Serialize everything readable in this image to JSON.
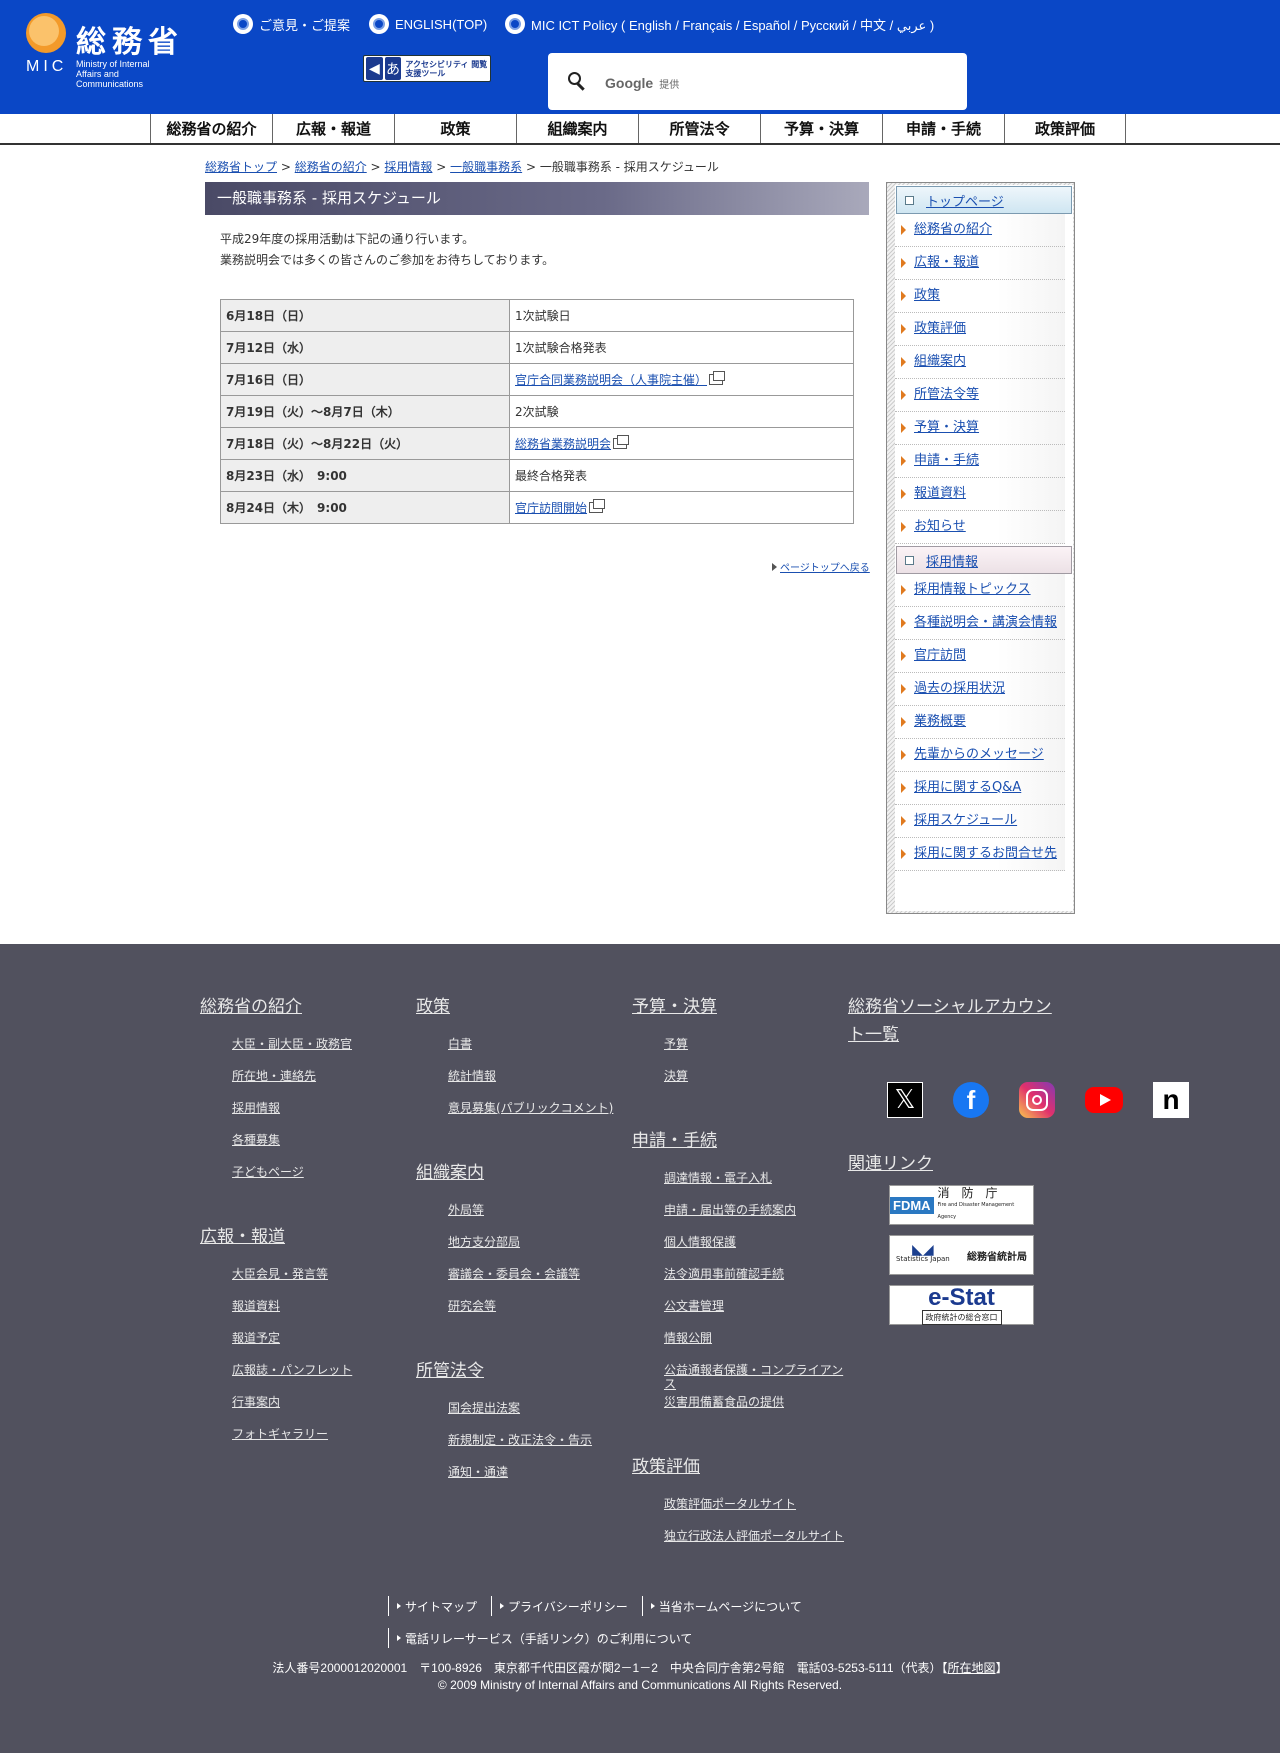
{
  "header": {
    "logo_kanji": "総務省",
    "logo_mic": "MIC",
    "logo_ministry": "Ministry of Internal Affairs and Communications",
    "links": [
      "ご意見・ご提案",
      "ENGLISH(TOP)",
      "MIC ICT Policy ( English / Français / Español / Русский / 中文 / عربي )"
    ],
    "accessibility_label": "アクセシビリティ 閲覧支援ツール",
    "search": {
      "placeholder": "",
      "provider_label": "Google",
      "provider_suffix": "提供"
    }
  },
  "gnav": [
    "総務省の紹介",
    "広報・報道",
    "政策",
    "組織案内",
    "所管法令",
    "予算・決算",
    "申請・手続",
    "政策評価"
  ],
  "breadcrumb": {
    "links": [
      "総務省トップ",
      "総務省の紹介",
      "採用情報",
      "一般職事務系"
    ],
    "separator": " > ",
    "current": "一般職事務系 - 採用スケジュール"
  },
  "main": {
    "title": "一般職事務系 - 採用スケジュール",
    "intro": [
      "平成29年度の採用活動は下記の通り行います。",
      "業務説明会では多くの皆さんのご参加をお待ちしております。"
    ],
    "schedule": [
      {
        "date": "6月18日（日）",
        "event": "1次試験日",
        "link": false
      },
      {
        "date": "7月12日（水）",
        "event": "1次試験合格発表",
        "link": false
      },
      {
        "date": "7月16日（日）",
        "event": "官庁合同業務説明会（人事院主催）",
        "link": true
      },
      {
        "date": "7月19日（火）～8月7日（木）",
        "event": "2次試験",
        "link": false
      },
      {
        "date": "7月18日（火）～8月22日（火）",
        "event": "総務省業務説明会",
        "link": true
      },
      {
        "date": "8月23日（水）　9:00",
        "event": "最終合格発表",
        "link": false
      },
      {
        "date": "8月24日（木）　9:00",
        "event": "官庁訪問開始",
        "link": true
      }
    ],
    "page_top": "ページトップへ戻る"
  },
  "sidenav": {
    "head1": "トップページ",
    "items1": [
      "総務省の紹介",
      "広報・報道",
      "政策",
      "政策評価",
      "組織案内",
      "所管法令等",
      "予算・決算",
      "申請・手続",
      "報道資料",
      "お知らせ"
    ],
    "head2": "採用情報",
    "items2": [
      "採用情報トピックス",
      "各種説明会・講演会情報",
      "官庁訪問",
      "過去の採用状況",
      "業務概要",
      "先輩からのメッセージ",
      "採用に関するQ&A",
      "採用スケジュール",
      "採用に関するお問合せ先"
    ]
  },
  "footer": {
    "col1": [
      {
        "title": "総務省の紹介",
        "items": [
          "大臣・副大臣・政務官",
          "所在地・連絡先",
          "採用情報",
          "各種募集",
          "子どもページ"
        ]
      },
      {
        "title": "広報・報道",
        "items": [
          "大臣会見・発言等",
          "報道資料",
          "報道予定",
          "広報誌・パンフレット",
          "行事案内",
          "フォトギャラリー"
        ]
      }
    ],
    "col2": [
      {
        "title": "政策",
        "items": [
          "白書",
          "統計情報",
          "意見募集(パブリックコメント)"
        ]
      },
      {
        "title": "組織案内",
        "items": [
          "外局等",
          "地方支分部局",
          "審議会・委員会・会議等",
          "研究会等"
        ]
      },
      {
        "title": "所管法令",
        "items": [
          "国会提出法案",
          "新規制定・改正法令・告示",
          "通知・通達"
        ]
      }
    ],
    "col3": [
      {
        "title": "予算・決算",
        "items": [
          "予算",
          "決算"
        ]
      },
      {
        "title": "申請・手続",
        "items": [
          "調達情報・電子入札",
          "申請・届出等の手続案内",
          "個人情報保護",
          "法令適用事前確認手続",
          "公文書管理",
          "情報公開",
          "公益通報者保護・コンプライアンス",
          "災害用備蓄食品の提供"
        ]
      },
      {
        "title": "政策評価",
        "items": [
          "政策評価ポータルサイト",
          "独立行政法人評価ポータルサイト"
        ]
      }
    ],
    "social_title": "総務省ソーシャルアカウント一覧",
    "related_title": "関連リンク",
    "banners": {
      "fdma_logo": "FDMA",
      "fdma_name": "消　防　庁",
      "fdma_en": "Fire and Disaster Management Agency",
      "stat_en": "Statistics Japan",
      "stat_name": "総務省統計局",
      "estat_name": "e-Stat",
      "estat_sub": "政府統計の総合窓口"
    },
    "links": [
      "サイトマップ",
      "プライバシーポリシー",
      "当省ホームページについて",
      "電話リレーサービス（手話リンク）のご利用について"
    ],
    "address": "法人番号2000012020001　〒100-8926　東京都千代田区霞が関2－1－2　中央合同庁舎第2号館　電話03-5253-5111（代表）",
    "map_link": "所在地図",
    "copyright": "© 2009 Ministry of Internal Affairs and Communications All Rights Reserved."
  }
}
